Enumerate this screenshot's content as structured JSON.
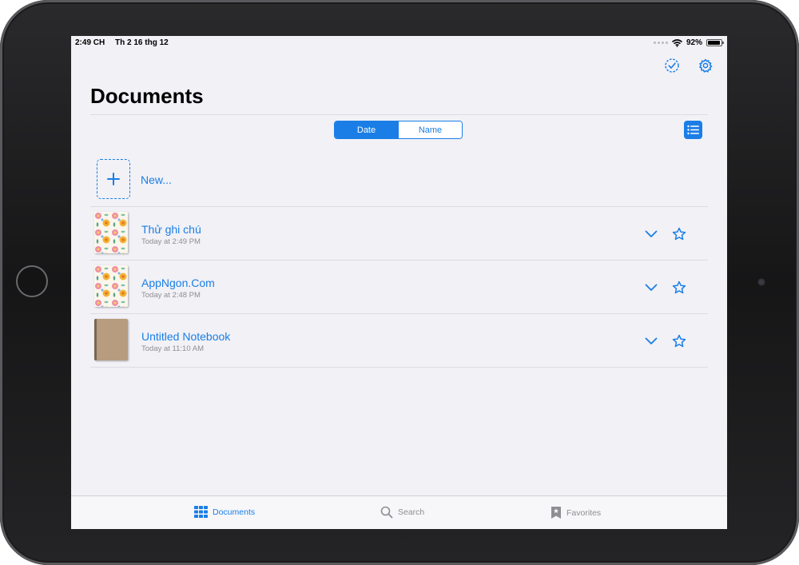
{
  "status_bar": {
    "time": "2:49 CH",
    "date": "Th 2 16 thg 12",
    "battery": "92%",
    "battery_level": 0.92
  },
  "header": {
    "title": "Documents",
    "select_icon": "checkmark-circle-dashed-icon",
    "settings_icon": "gear-icon"
  },
  "sort": {
    "options": [
      "Date",
      "Name"
    ],
    "selected": "Date"
  },
  "view_toggle_icon": "list-icon",
  "new_document": {
    "label": "New..."
  },
  "documents": [
    {
      "title": "Thử ghi chú",
      "modified": "Today at 2:49 PM",
      "cover": "floral"
    },
    {
      "title": "AppNgon.Com",
      "modified": "Today at 2:48 PM",
      "cover": "floral"
    },
    {
      "title": "Untitled Notebook",
      "modified": "Today at 11:10 AM",
      "cover": "kraft"
    }
  ],
  "tab_bar": {
    "tabs": [
      {
        "label": "Documents",
        "icon": "grid-icon",
        "active": true
      },
      {
        "label": "Search",
        "icon": "search-icon",
        "active": false
      },
      {
        "label": "Favorites",
        "icon": "bookmark-star-icon",
        "active": false
      }
    ]
  },
  "colors": {
    "accent": "#1a7ee6",
    "background": "#f1f1f6",
    "secondary_text": "#8e8e93"
  }
}
